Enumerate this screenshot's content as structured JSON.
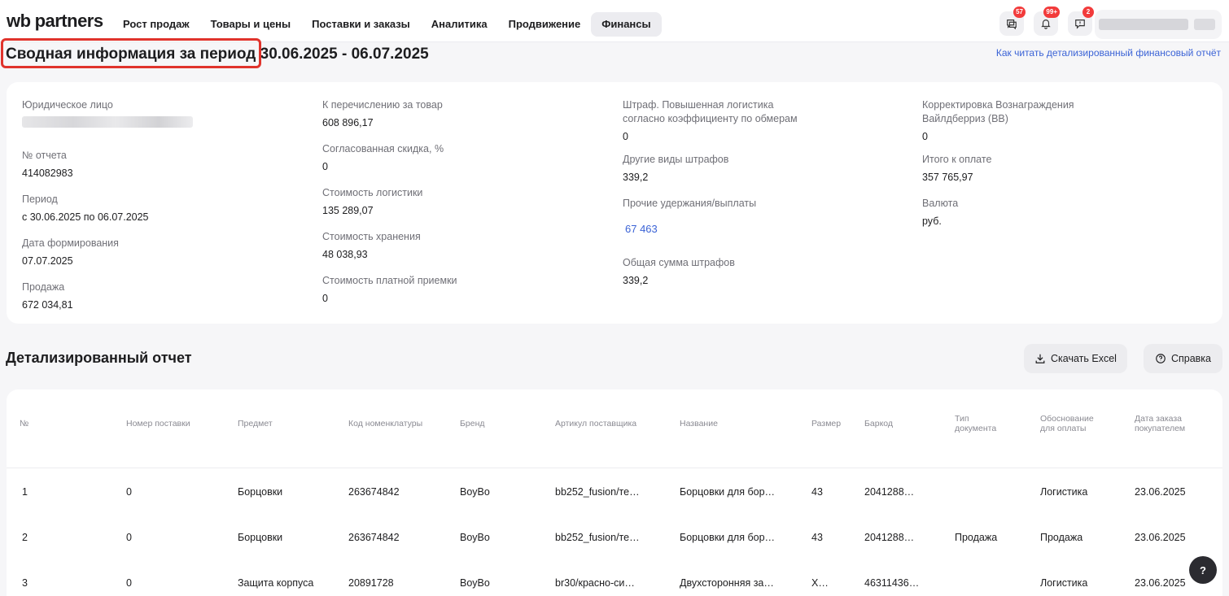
{
  "header": {
    "logo_wb": "wb",
    "logo_partners": "partners",
    "nav": [
      "Рост продаж",
      "Товары и цены",
      "Поставки и заказы",
      "Аналитика",
      "Продвижение",
      "Финансы"
    ],
    "badges": {
      "chat": "57",
      "notifications": "99+",
      "feedback": "2"
    }
  },
  "page": {
    "title": "Сводная информация за период 30.06.2025 - 06.07.2025",
    "help_link": "Как читать детализированный финансовый отчёт"
  },
  "summary": {
    "col1": {
      "legal_entity_label": "Юридическое лицо",
      "report_no_label": "№ отчета",
      "report_no": "414082983",
      "period_label": "Период",
      "period": "с 30.06.2025 по 06.07.2025",
      "created_label": "Дата формирования",
      "created": "07.07.2025",
      "sale_label": "Продажа",
      "sale": "672 034,81"
    },
    "col2": {
      "transfer_label": "К перечислению за товар",
      "transfer": "608 896,17",
      "discount_label": "Согласованная скидка, %",
      "discount": "0",
      "logistics_label": "Стоимость логистики",
      "logistics": "135 289,07",
      "storage_label": "Стоимость хранения",
      "storage": "48 038,93",
      "acceptance_label": "Стоимость платной приемки",
      "acceptance": "0"
    },
    "col3": {
      "fine_logistics_label_1": "Штраф. Повышенная логистика",
      "fine_logistics_label_2": "согласно коэффициенту по обмерам",
      "fine_logistics": "0",
      "other_fines_label": "Другие виды штрафов",
      "other_fines": "339,2",
      "other_deductions_label": "Прочие удержания/выплаты",
      "other_deductions": "67 463",
      "total_fines_label": "Общая сумма штрафов",
      "total_fines": "339,2"
    },
    "col4": {
      "correction_label_1": "Корректировка Вознаграждения",
      "correction_label_2": "Вайлдберриз (ВВ)",
      "correction": "0",
      "total_label": "Итого к оплате",
      "total": "357 765,97",
      "currency_label": "Валюта",
      "currency": "руб."
    }
  },
  "detail": {
    "title": "Детализированный отчет",
    "excel_button": "Скачать Excel",
    "help_button": "Справка",
    "columns": {
      "no": "№",
      "supply_no": "Номер поставки",
      "subject": "Предмет",
      "nm_code": "Код номенклатуры",
      "brand": "Бренд",
      "article": "Артикул поставщика",
      "name": "Название",
      "size": "Размер",
      "barcode": "Баркод",
      "doc_type_1": "Тип",
      "doc_type_2": "документа",
      "reason_1": "Обоснование",
      "reason_2": "для оплаты",
      "order_date_1": "Дата заказа",
      "order_date_2": "покупателем"
    },
    "rows": [
      {
        "no": "1",
        "supply": "0",
        "subject": "Борцовки",
        "nm": "263674842",
        "brand": "BoyBo",
        "article": "bb252_fusion/те…",
        "name": "Борцовки для бор…",
        "size": "43",
        "barcode": "2041288…",
        "doc": "",
        "reason": "Логистика",
        "date": "23.06.2025"
      },
      {
        "no": "2",
        "supply": "0",
        "subject": "Борцовки",
        "nm": "263674842",
        "brand": "BoyBo",
        "article": "bb252_fusion/те…",
        "name": "Борцовки для бор…",
        "size": "43",
        "barcode": "2041288…",
        "doc": "Продажа",
        "reason": "Продажа",
        "date": "23.06.2025"
      },
      {
        "no": "3",
        "supply": "0",
        "subject": "Защита корпуса",
        "nm": "20891728",
        "brand": "BoyBo",
        "article": "br30/красно-си…",
        "name": "Двухсторонняя за…",
        "size": "X…",
        "barcode": "46311436…",
        "doc": "",
        "reason": "Логистика",
        "date": "23.06.2025"
      }
    ]
  },
  "float_help": "?"
}
